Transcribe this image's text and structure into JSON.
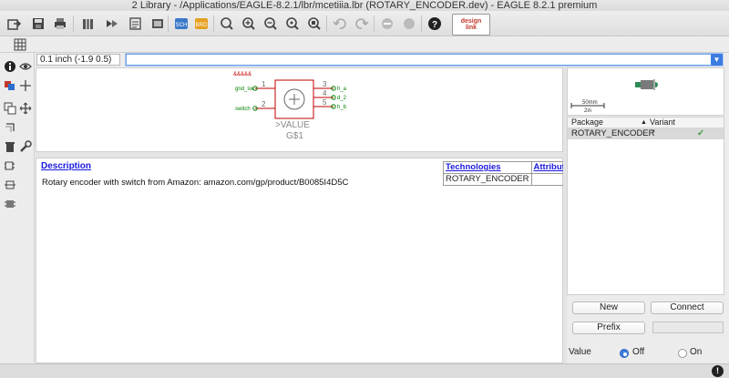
{
  "window": {
    "title": "2 Library - /Applications/EAGLE-8.2.1/lbr/mcetiiia.lbr (ROTARY_ENCODER.dev) - EAGLE 8.2.1 premium"
  },
  "toolbar": {
    "designlink_line1": "design",
    "designlink_line2": "link"
  },
  "command": {
    "coordinates": "0.1 inch (-1.9 0.5)",
    "value": ""
  },
  "symbol": {
    "value_label": ">VALUE",
    "name_label": "G$1",
    "pins": [
      {
        "name": "gnd_sw",
        "number": "1"
      },
      {
        "name": "switch",
        "number": "2"
      },
      {
        "name": "h_a",
        "number": "3"
      },
      {
        "name": "d_2",
        "number": "4"
      },
      {
        "name": "h_b",
        "number": "5"
      }
    ],
    "top_marks": "&&&&&"
  },
  "description": {
    "title": "Description",
    "text": "Rotary encoder with switch from Amazon: amazon.com/gp/product/B0085I4D5C"
  },
  "tech_table": {
    "headers": [
      "Technologies",
      "Attributes"
    ],
    "rows": [
      [
        "ROTARY_ENCODER",
        ""
      ]
    ]
  },
  "package_preview": {
    "scale_top": "50mm",
    "scale_bottom": "2in"
  },
  "package_table": {
    "headers": [
      "Package",
      "Variant"
    ],
    "rows": [
      {
        "package": "ROTARY_ENCODER",
        "variant": "''"
      }
    ]
  },
  "buttons": {
    "new": "New",
    "connect": "Connect",
    "prefix": "Prefix"
  },
  "value_option": {
    "label": "Value",
    "off": "Off",
    "on": "On",
    "selected": "Off"
  },
  "colors": {
    "accent": "#3d7ce0",
    "link": "#1a1ae0",
    "pin": "#c00000",
    "pin_name": "#008000",
    "check": "#2e9e2e"
  }
}
